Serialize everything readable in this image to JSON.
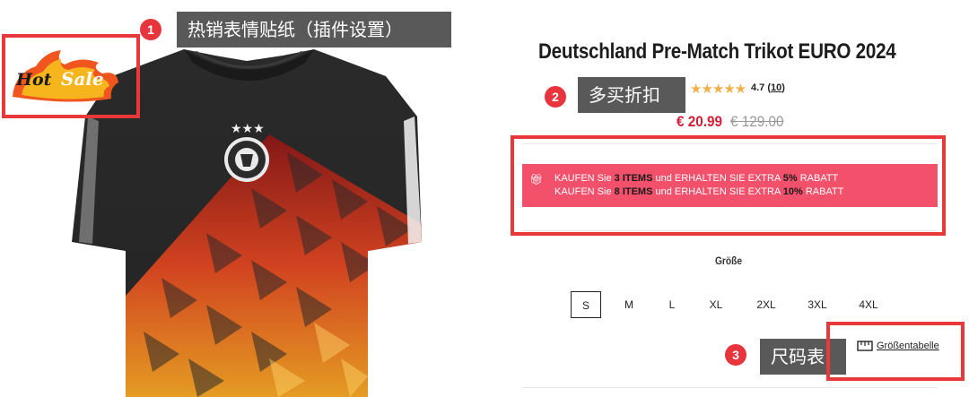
{
  "callouts": [
    {
      "number": "1",
      "text": "热销表情贴纸（插件设置）"
    },
    {
      "number": "2",
      "text": "多买折扣"
    },
    {
      "number": "3",
      "text": "尺码表"
    }
  ],
  "badge": {
    "hot": "Hot",
    "sale": "Sale"
  },
  "product": {
    "title": "Deutschland Pre-Match Trikot EURO 2024",
    "rating": "4.7",
    "review_count": "10",
    "price_current": "€ 20.99",
    "price_old": "€ 129.00",
    "rating_stars": 5
  },
  "discount": {
    "line1": {
      "a": "KAUFEN Sie ",
      "qty": "3 ITEMS",
      "b": " und ERHALTEN SIE EXTRA ",
      "pct": "5%",
      "c": " RABATT"
    },
    "line2": {
      "a": "KAUFEN Sie ",
      "qty": "8 ITEMS",
      "b": " und ERHALTEN SIE EXTRA ",
      "pct": "10%",
      "c": " RABATT"
    }
  },
  "size": {
    "label": "Größe",
    "options": [
      "S",
      "M",
      "L",
      "XL",
      "2XL",
      "3XL",
      "4XL"
    ],
    "selected": "S",
    "table_link": "Größentabelle"
  },
  "colors": {
    "accent": "#d21d34",
    "discount_bg": "#f2506b",
    "highlight_frame": "#e8383a",
    "callout_bg": "#595959"
  }
}
